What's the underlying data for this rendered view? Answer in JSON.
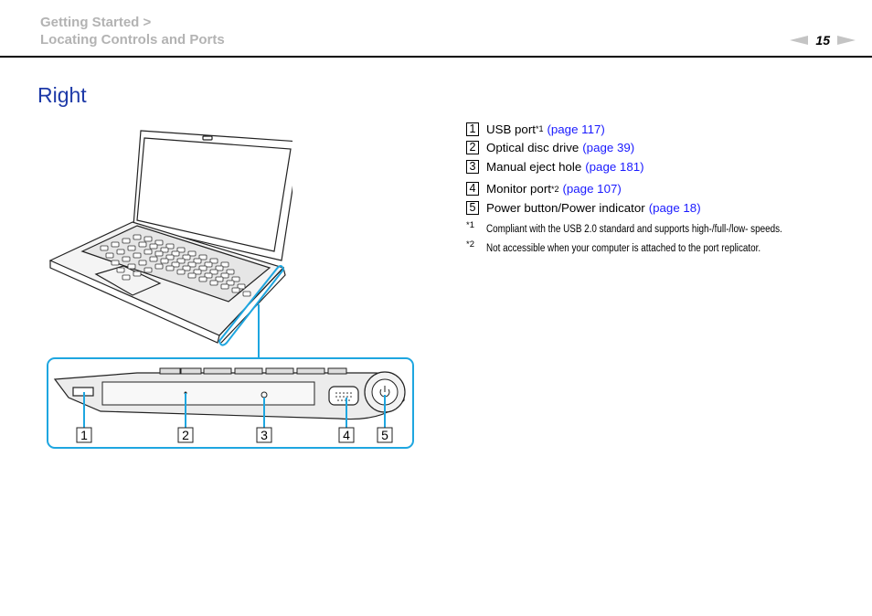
{
  "header": {
    "breadcrumb_line1": "Getting Started >",
    "breadcrumb_line2": "Locating Controls and Ports",
    "page_number": "15",
    "prev_icon": "triangle-left-icon",
    "next_icon": "triangle-right-icon"
  },
  "section": {
    "title": "Right"
  },
  "items": [
    {
      "num": "1",
      "label": "USB port",
      "sup": "*1",
      "link": "(page 117)"
    },
    {
      "num": "2",
      "label": "Optical disc drive",
      "sup": "",
      "link": "(page 39)"
    },
    {
      "num": "3",
      "label": "Manual eject hole",
      "sup": "",
      "link": "(page 181)"
    },
    {
      "num": "4",
      "label": "Monitor port",
      "sup": "*2",
      "link": "(page 107)"
    },
    {
      "num": "5",
      "label": "Power button/Power indicator",
      "sup": "",
      "link": "(page 18)"
    }
  ],
  "footnotes": [
    {
      "mark": "*1",
      "text": "Compliant with the USB 2.0 standard and supports high-/full-/low- speeds."
    },
    {
      "mark": "*2",
      "text": "Not accessible when your computer is attached to the port replicator."
    }
  ],
  "illustration": {
    "callouts": [
      "1",
      "2",
      "3",
      "4",
      "5"
    ],
    "highlight_color": "#1ea6e0"
  }
}
